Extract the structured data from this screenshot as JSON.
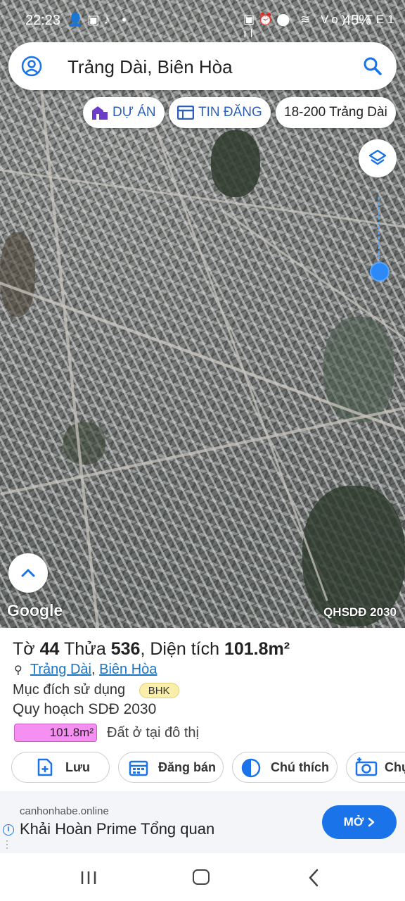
{
  "status_bar": {
    "time": "22:23",
    "left_icons": "👤▣♪ •",
    "right_icons": "▣⏰⬤ ≋ Vo) LTE1 ıl",
    "battery": "45%"
  },
  "search": {
    "query": "Trảng Dài, Biên Hòa"
  },
  "chips": {
    "du_an": "DỰ ÁN",
    "tin_dang": "TIN ĐĂNG",
    "address": "18-200 Trảng Dài"
  },
  "map": {
    "attribution": "Google",
    "overlay_label": "QHSDĐ 2030"
  },
  "parcel": {
    "to_label": "Tờ",
    "to_value": "44",
    "thua_label": "Thửa",
    "thua_value": "536",
    "area_label": "Diện tích",
    "area_value": "101.8m²",
    "ward": "Trảng Dài",
    "city": "Biên Hòa",
    "purpose_label": "Mục đích sử dụng",
    "purpose_code": "BHK",
    "plan_label": "Quy hoạch SDĐ 2030",
    "plan_area": "101.8m²",
    "plan_type": "Đất ở tại đô thị"
  },
  "actions": {
    "save": "Lưu",
    "post_sale": "Đăng bán",
    "legend": "Chú thích",
    "capture": "Chụ"
  },
  "ad": {
    "domain": "canhonhabe.online",
    "headline": "Khải Hoàn Prime Tổng quan",
    "cta": "MỞ",
    "accent": "#1a73e8"
  },
  "colors": {
    "primary_blue": "#2e5fb8",
    "plan_color": "#f58ff2",
    "bhk_badge": "#f9eeaa"
  }
}
